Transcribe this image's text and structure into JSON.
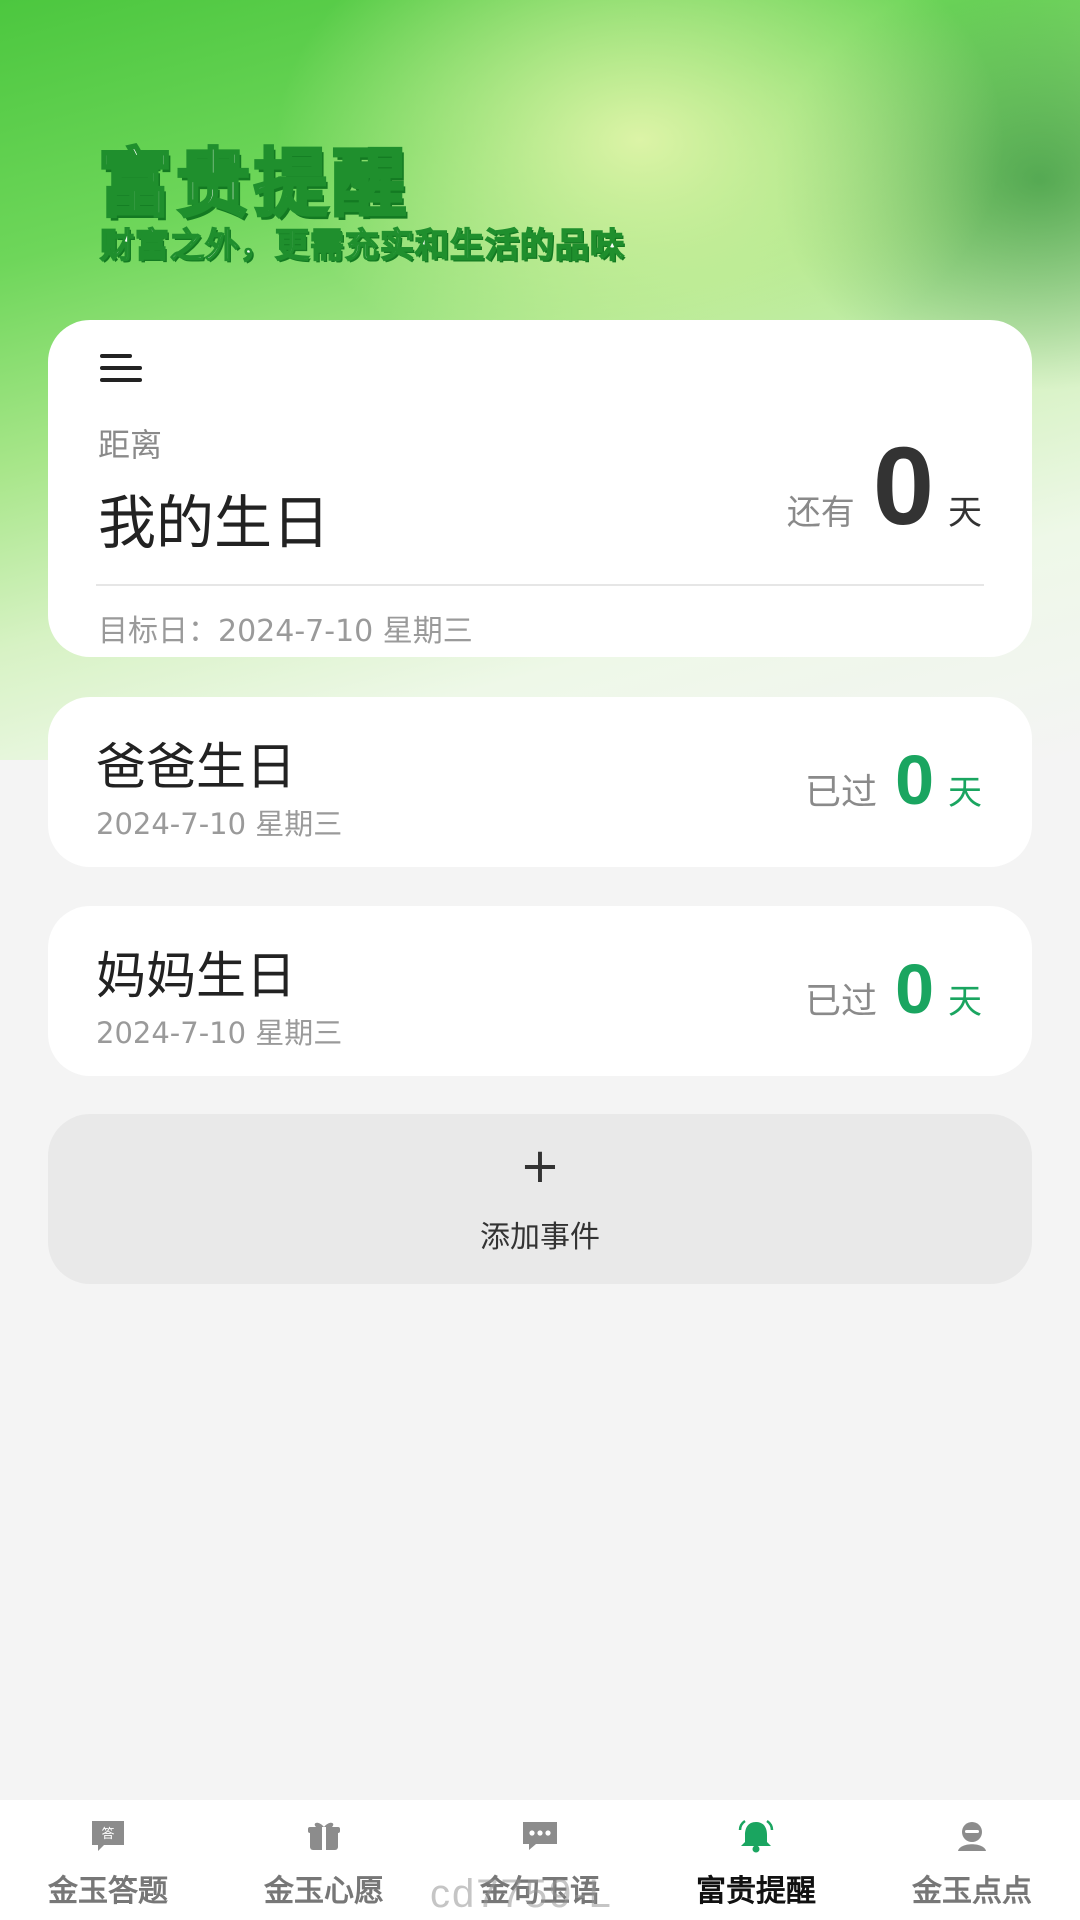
{
  "header": {
    "title": "富贵提醒",
    "subtitle": "财富之外，更需充实和生活的品味"
  },
  "main_card": {
    "menu_icon": "menu-icon",
    "label": "距离",
    "title": "我的生日",
    "prefix": "还有",
    "count": "0",
    "unit": "天",
    "target": "目标日：2024-7-10 星期三"
  },
  "events": [
    {
      "name": "爸爸生日",
      "date": "2024-7-10 星期三",
      "prefix": "已过",
      "count": "0",
      "unit": "天"
    },
    {
      "name": "妈妈生日",
      "date": "2024-7-10 星期三",
      "prefix": "已过",
      "count": "0",
      "unit": "天"
    }
  ],
  "add_event": {
    "icon": "+",
    "label": "添加事件"
  },
  "tabbar": {
    "tabs": [
      {
        "label": "金玉答题",
        "icon": "quiz-icon"
      },
      {
        "label": "金玉心愿",
        "icon": "gift-icon"
      },
      {
        "label": "金句玉语",
        "icon": "chat-icon"
      },
      {
        "label": "富贵提醒",
        "icon": "bell-icon",
        "active": true
      },
      {
        "label": "金玉点点",
        "icon": "user-icon"
      }
    ],
    "active_color": "#1aa560",
    "inactive_color": "#8c8c8c"
  },
  "watermark": "cd7759-L",
  "colors": {
    "accent": "#1aa560",
    "title_stroke": "#1f8f2d"
  }
}
